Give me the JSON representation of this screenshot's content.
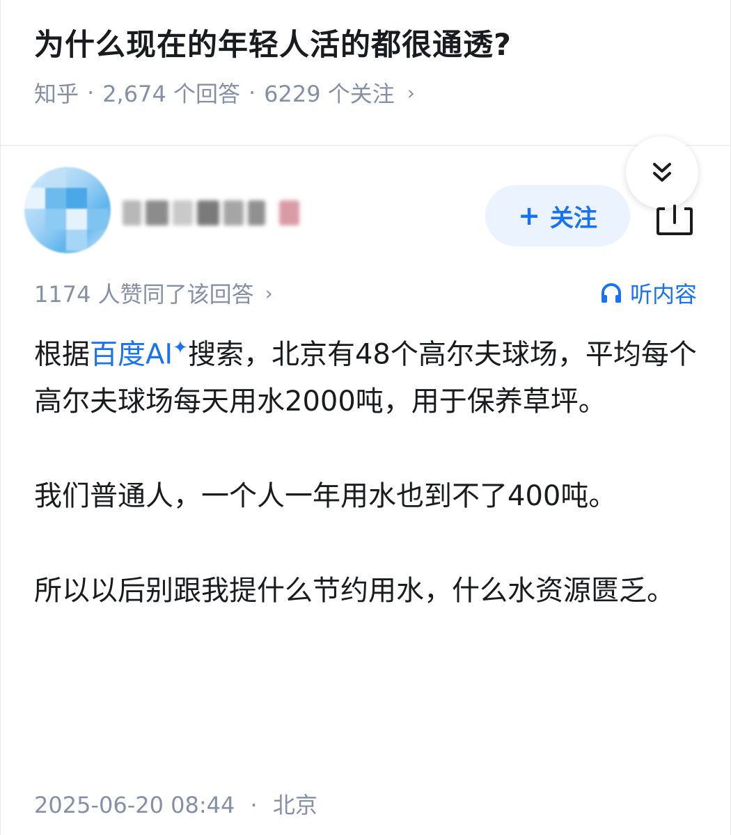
{
  "question": {
    "title": "为什么现在的年轻人活的都很通透?",
    "source": "知乎",
    "answers": "2,674 个回答",
    "followers": "6229 个关注",
    "meta_chevron": "›"
  },
  "author": {
    "follow_plus": "+",
    "follow_label": "关注"
  },
  "answer": {
    "agree_text": "1174 人赞同了该回答",
    "agree_chevron": "›",
    "listen_label": "听内容",
    "p1_prefix": "根据",
    "p1_link": "百度AI",
    "p1_spark": "✦",
    "p1_rest": "搜索，北京有48个高尔夫球场，平均每个高尔夫球场每天用水2000吨，用于保养草坪。",
    "p2": "我们普通人，一个人一年用水也到不了400吨。",
    "p3": "所以以后别跟我提什么节约用水，什么水资源匮乏。",
    "timestamp": "2025-06-20 08:44",
    "location": "北京"
  },
  "colors": {
    "accent": "#1772f6",
    "meta": "#8590a6",
    "text": "#191b1f",
    "follow_bg": "#eaf3ff"
  }
}
